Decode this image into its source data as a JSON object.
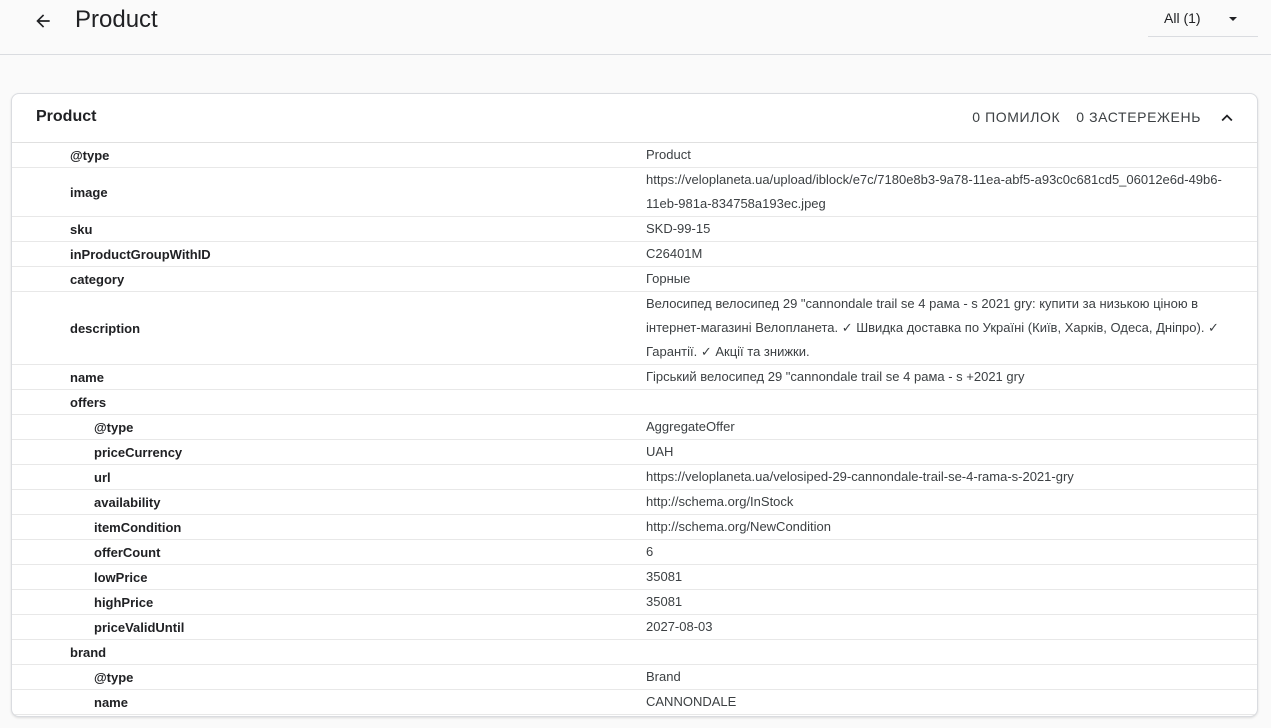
{
  "header": {
    "title": "Product",
    "filter_value": "All (1)"
  },
  "card": {
    "title": "Product",
    "errors_label": "0 ПОМИЛОК",
    "warnings_label": "0 ЗАСТЕРЕЖЕНЬ"
  },
  "rows": [
    {
      "key": "@type",
      "value": "Product",
      "level": 0
    },
    {
      "key": "image",
      "value": "https://veloplaneta.ua/upload/iblock/e7c/7180e8b3-9a78-11ea-abf5-a93c0c681cd5_06012e6d-49b6-11eb-981a-834758a193ec.jpeg",
      "level": 0
    },
    {
      "key": "sku",
      "value": "SKD-99-15",
      "level": 0
    },
    {
      "key": "inProductGroupWithID",
      "value": "C26401M",
      "level": 0
    },
    {
      "key": "category",
      "value": "Горные",
      "level": 0
    },
    {
      "key": "description",
      "value": "Велосипед велосипед 29 \"cannondale trail se 4 рама - s 2021 gry: купити за низькою ціною в інтернет-магазині Велопланета. ✓ Швидка доставка по Україні (Київ, Харків, Одеса, Дніпро). ✓ Гарантії. ✓ Акції та знижки.",
      "level": 0
    },
    {
      "key": "name",
      "value": "Гірський велосипед 29 \"cannondale trail se 4 рама - s +2021 gry",
      "level": 0
    },
    {
      "key": "offers",
      "value": "",
      "level": 0
    },
    {
      "key": "@type",
      "value": "AggregateOffer",
      "level": 1
    },
    {
      "key": "priceCurrency",
      "value": "UAH",
      "level": 1
    },
    {
      "key": "url",
      "value": "https://veloplaneta.ua/velosiped-29-cannondale-trail-se-4-rama-s-2021-gry",
      "level": 1
    },
    {
      "key": "availability",
      "value": "http://schema.org/InStock",
      "level": 1
    },
    {
      "key": "itemCondition",
      "value": "http://schema.org/NewCondition",
      "level": 1
    },
    {
      "key": "offerCount",
      "value": "6",
      "level": 1
    },
    {
      "key": "lowPrice",
      "value": "35081",
      "level": 1
    },
    {
      "key": "highPrice",
      "value": "35081",
      "level": 1
    },
    {
      "key": "priceValidUntil",
      "value": "2027-08-03",
      "level": 1
    },
    {
      "key": "brand",
      "value": "",
      "level": 0
    },
    {
      "key": "@type",
      "value": "Brand",
      "level": 1
    },
    {
      "key": "name",
      "value": "CANNONDALE",
      "level": 1
    }
  ],
  "icons": {
    "back": "arrow-back-icon",
    "filter_caret": "caret-down-icon",
    "collapse": "chevron-up-icon"
  }
}
